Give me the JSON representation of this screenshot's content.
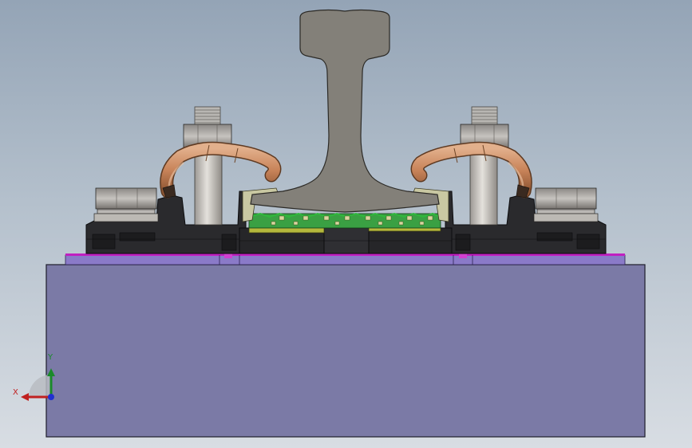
{
  "viewport": {
    "background_top": "#94a4b6",
    "background_bottom": "#d8dde3"
  },
  "model": {
    "sleeper_color": "#7b7aa6",
    "rail_color": "#838079",
    "clip_color": "#c9845a",
    "bolt_color": "#c8c6c3",
    "baseplate_color": "#2a2a2d",
    "pad_color": "#3aa043",
    "pad_top_color": "#2fb83c",
    "shim_color": "#b4b83c",
    "insulator_color": "#c9c8a2",
    "rubber_pad_color": "#8a7ac8",
    "highlight_color": "#c020c0"
  },
  "triad": {
    "x_label": "X",
    "y_label": "Y",
    "x_color": "#c02020",
    "y_color": "#1a8a2a",
    "z_color": "#2030d0"
  }
}
